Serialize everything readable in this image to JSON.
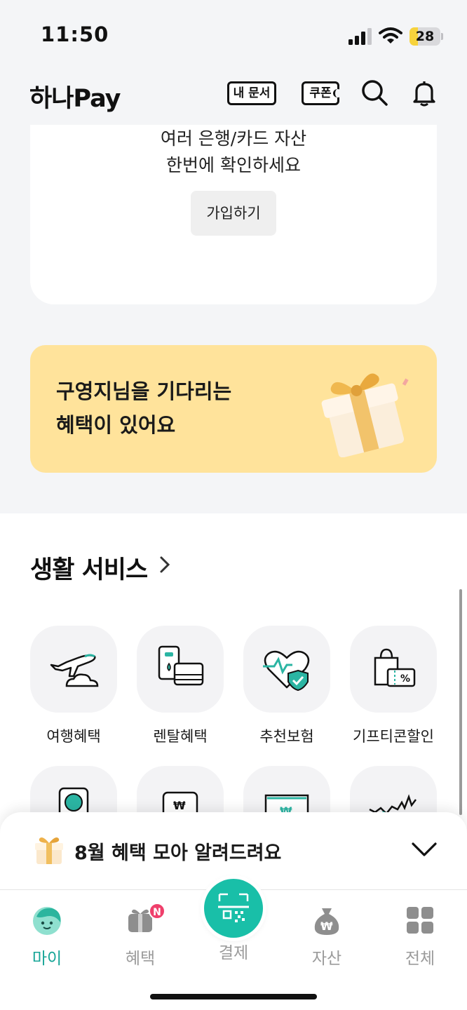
{
  "status_bar": {
    "time": "11:50",
    "battery": "28",
    "battery_level": 0.28
  },
  "header": {
    "logo": "하나Pay",
    "docs_label": "내 문서",
    "coupon_label": "쿠폰"
  },
  "signup_card": {
    "line1": "여러 은행/카드 자산",
    "line2": "한번에 확인하세요",
    "button_label": "가입하기"
  },
  "benefit_banner": {
    "line1": "구영지님을 기다리는",
    "line2": "혜택이 있어요"
  },
  "life_services": {
    "title": "생활 서비스",
    "items": [
      {
        "label": "여행혜택",
        "icon": "airplane-icon"
      },
      {
        "label": "렌탈혜택",
        "icon": "rental-appliance-icon"
      },
      {
        "label": "추천보험",
        "icon": "heart-shield-icon"
      },
      {
        "label": "기프티콘할인",
        "icon": "gift-discount-icon"
      }
    ],
    "items_row2_icons": [
      "won-phone-icon",
      "won-card-icon",
      "won-screen-icon",
      "stock-chart-icon"
    ]
  },
  "notice": {
    "text": "8월 혜택 모아 알려드려요"
  },
  "bottom_nav": {
    "items": [
      {
        "label": "마이",
        "active": true
      },
      {
        "label": "혜택",
        "badge": "N"
      },
      {
        "label": "결제"
      },
      {
        "label": "자산"
      },
      {
        "label": "전체"
      }
    ]
  },
  "colors": {
    "accent": "#16a597",
    "banner_bg": "#ffe39b",
    "badge": "#ef3f6b"
  }
}
